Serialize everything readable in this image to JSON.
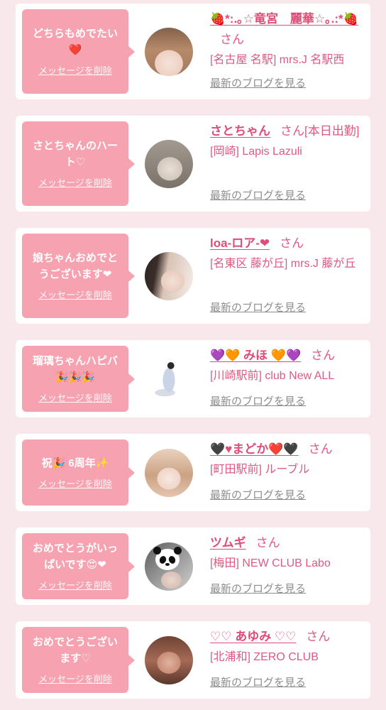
{
  "theme": {
    "background": "#f8e7eb",
    "bubble": "#f6a2b0",
    "name": "#dc4d77",
    "text": "#dd5a82",
    "link": "#8d8d8d"
  },
  "messages": [
    {
      "bubble_text": "どちらもめでたい❤️",
      "delete_label": "メッセージを削除",
      "name": "🍓*:.｡☆竜宮　麗華☆｡.:*🍓",
      "honorific": "さん",
      "store": "[名古屋 名駅] mrs.J 名駅西",
      "blog_link": "最新のブログを見る"
    },
    {
      "bubble_text": "さとちゃんのハート♡",
      "delete_label": "メッセージを削除",
      "name": "さとちゃん",
      "honorific": "さん",
      "status": "[本日出勤]",
      "store": "[岡崎] Lapis Lazuli",
      "blog_link": "最新のブログを見る"
    },
    {
      "bubble_text": "娘ちゃんおめでとうございます❤",
      "delete_label": "メッセージを削除",
      "name": "loa-ロア-❤",
      "honorific": "さん",
      "store": "[名東区 藤が丘] mrs.J 藤が丘",
      "blog_link": "最新のブログを見る"
    },
    {
      "bubble_text": "瑠璃ちゃんハピバ🎉🎉🎉",
      "delete_label": "メッセージを削除",
      "name": "💜🧡 みほ 🧡💜",
      "honorific": "さん",
      "store": "[川崎駅前] club New ALL",
      "blog_link": "最新のブログを見る"
    },
    {
      "bubble_text": "祝🎉 6周年✨",
      "delete_label": "メッセージを削除",
      "name": "🖤♥まどか❤️🖤",
      "honorific": "さん",
      "store": "[町田駅前] ルーブル",
      "blog_link": "最新のブログを見る"
    },
    {
      "bubble_text": "おめでとうがいっぱいです😍❤",
      "delete_label": "メッセージを削除",
      "name": "ツムギ",
      "honorific": "さん",
      "store": "[梅田] NEW CLUB Labo",
      "blog_link": "最新のブログを見る"
    },
    {
      "bubble_text": "おめでとうございます♡",
      "delete_label": "メッセージを削除",
      "name": "♡♡ あゆみ ♡♡",
      "honorific": "さん",
      "store": "[北浦和] ZERO CLUB",
      "blog_link": "最新のブログを見る"
    }
  ]
}
